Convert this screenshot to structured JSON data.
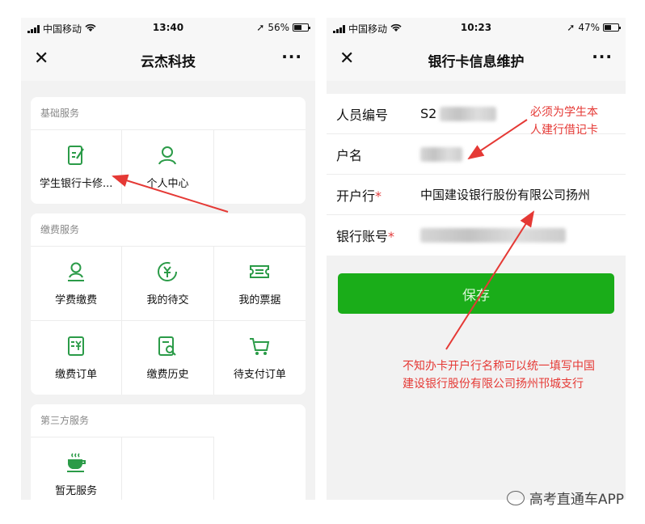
{
  "left_phone": {
    "status": {
      "carrier": "中国移动",
      "time": "13:40",
      "battery": "56%",
      "battery_level": 0.56
    },
    "nav": {
      "title": "云杰科技",
      "close": "✕",
      "more": "···"
    },
    "sections": [
      {
        "title": "基础服务",
        "items": [
          {
            "label": "学生银行卡修...",
            "icon": "edit-form-icon"
          },
          {
            "label": "个人中心",
            "icon": "user-icon"
          }
        ]
      },
      {
        "title": "缴费服务",
        "items": [
          {
            "label": "学费缴费",
            "icon": "user-pay-icon"
          },
          {
            "label": "我的待交",
            "icon": "yuan-refresh-icon"
          },
          {
            "label": "我的票据",
            "icon": "ticket-icon"
          },
          {
            "label": "缴费订单",
            "icon": "yuan-document-icon"
          },
          {
            "label": "缴费历史",
            "icon": "search-document-icon"
          },
          {
            "label": "待支付订单",
            "icon": "cart-icon"
          }
        ]
      },
      {
        "title": "第三方服务",
        "items": [
          {
            "label": "暂无服务",
            "icon": "coffee-cup-icon"
          }
        ]
      }
    ]
  },
  "right_phone": {
    "status": {
      "carrier": "中国移动",
      "time": "10:23",
      "battery": "47%",
      "battery_level": 0.47
    },
    "nav": {
      "title": "银行卡信息维护",
      "close": "✕",
      "more": "···"
    },
    "form": {
      "staff_no": {
        "label": "人员编号",
        "value": "S2"
      },
      "name": {
        "label": "户名"
      },
      "bank": {
        "label": "开户行",
        "required": "*",
        "value": "中国建设银行股份有限公司扬州"
      },
      "account": {
        "label": "银行账号",
        "required": "*"
      }
    },
    "save_label": "保存"
  },
  "annotations": {
    "top": [
      "必须为学生本",
      "人建行借记卡"
    ],
    "bottom": [
      "不知办卡开户行名称可以统一填写中国",
      "建设银行股份有限公司扬州邗城支行"
    ]
  },
  "watermark": "高考直通车APP",
  "colors": {
    "accent_green": "#1aad19",
    "icon_green": "#2b9b48",
    "annotation_red": "#e53935"
  }
}
